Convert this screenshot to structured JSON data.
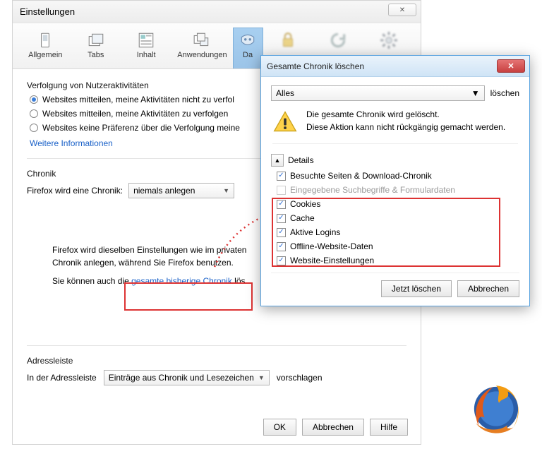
{
  "settings": {
    "title": "Einstellungen",
    "tabs": {
      "allgemein": "Allgemein",
      "tabs": "Tabs",
      "inhalt": "Inhalt",
      "anwendungen": "Anwendungen",
      "datenschutz_cut": "Da"
    },
    "tracking": {
      "heading": "Verfolgung von Nutzeraktivitäten",
      "opt1": "Websites mitteilen, meine Aktivitäten nicht zu verfol",
      "opt2": "Websites mitteilen, meine Aktivitäten zu verfolgen",
      "opt3": "Websites keine Präferenz über die Verfolgung meine",
      "more_info": "Weitere Informationen"
    },
    "history": {
      "heading": "Chronik",
      "label": "Firefox wird eine Chronik:",
      "mode": "niemals anlegen",
      "desc1": "Firefox wird dieselben Einstellungen wie im privaten",
      "desc2": "Chronik anlegen, während Sie Firefox benutzen.",
      "linkrow_pre": "Sie können auch die ",
      "linkrow_link": "gesamte bisherige Chronik",
      "linkrow_post": " lös"
    },
    "addressbar": {
      "heading": "Adressleiste",
      "label": "In der Adressleiste",
      "select": "Einträge aus Chronik und Lesezeichen",
      "suffix": "vorschlagen"
    },
    "buttons": {
      "ok": "OK",
      "cancel": "Abbrechen",
      "help": "Hilfe"
    }
  },
  "dialog": {
    "title": "Gesamte Chronik löschen",
    "range_select": "Alles",
    "range_action": "löschen",
    "warn1": "Die gesamte Chronik wird gelöscht.",
    "warn2": "Diese Aktion kann nicht rückgängig gemacht werden.",
    "details": "Details",
    "items": {
      "visited": "Besuchte Seiten & Download-Chronik",
      "form": "Eingegebene Suchbegriffe & Formulardaten",
      "cookies": "Cookies",
      "cache": "Cache",
      "logins": "Aktive Logins",
      "offline": "Offline-Website-Daten",
      "siteprefs": "Website-Einstellungen"
    },
    "buttons": {
      "clear": "Jetzt löschen",
      "cancel": "Abbrechen"
    }
  }
}
